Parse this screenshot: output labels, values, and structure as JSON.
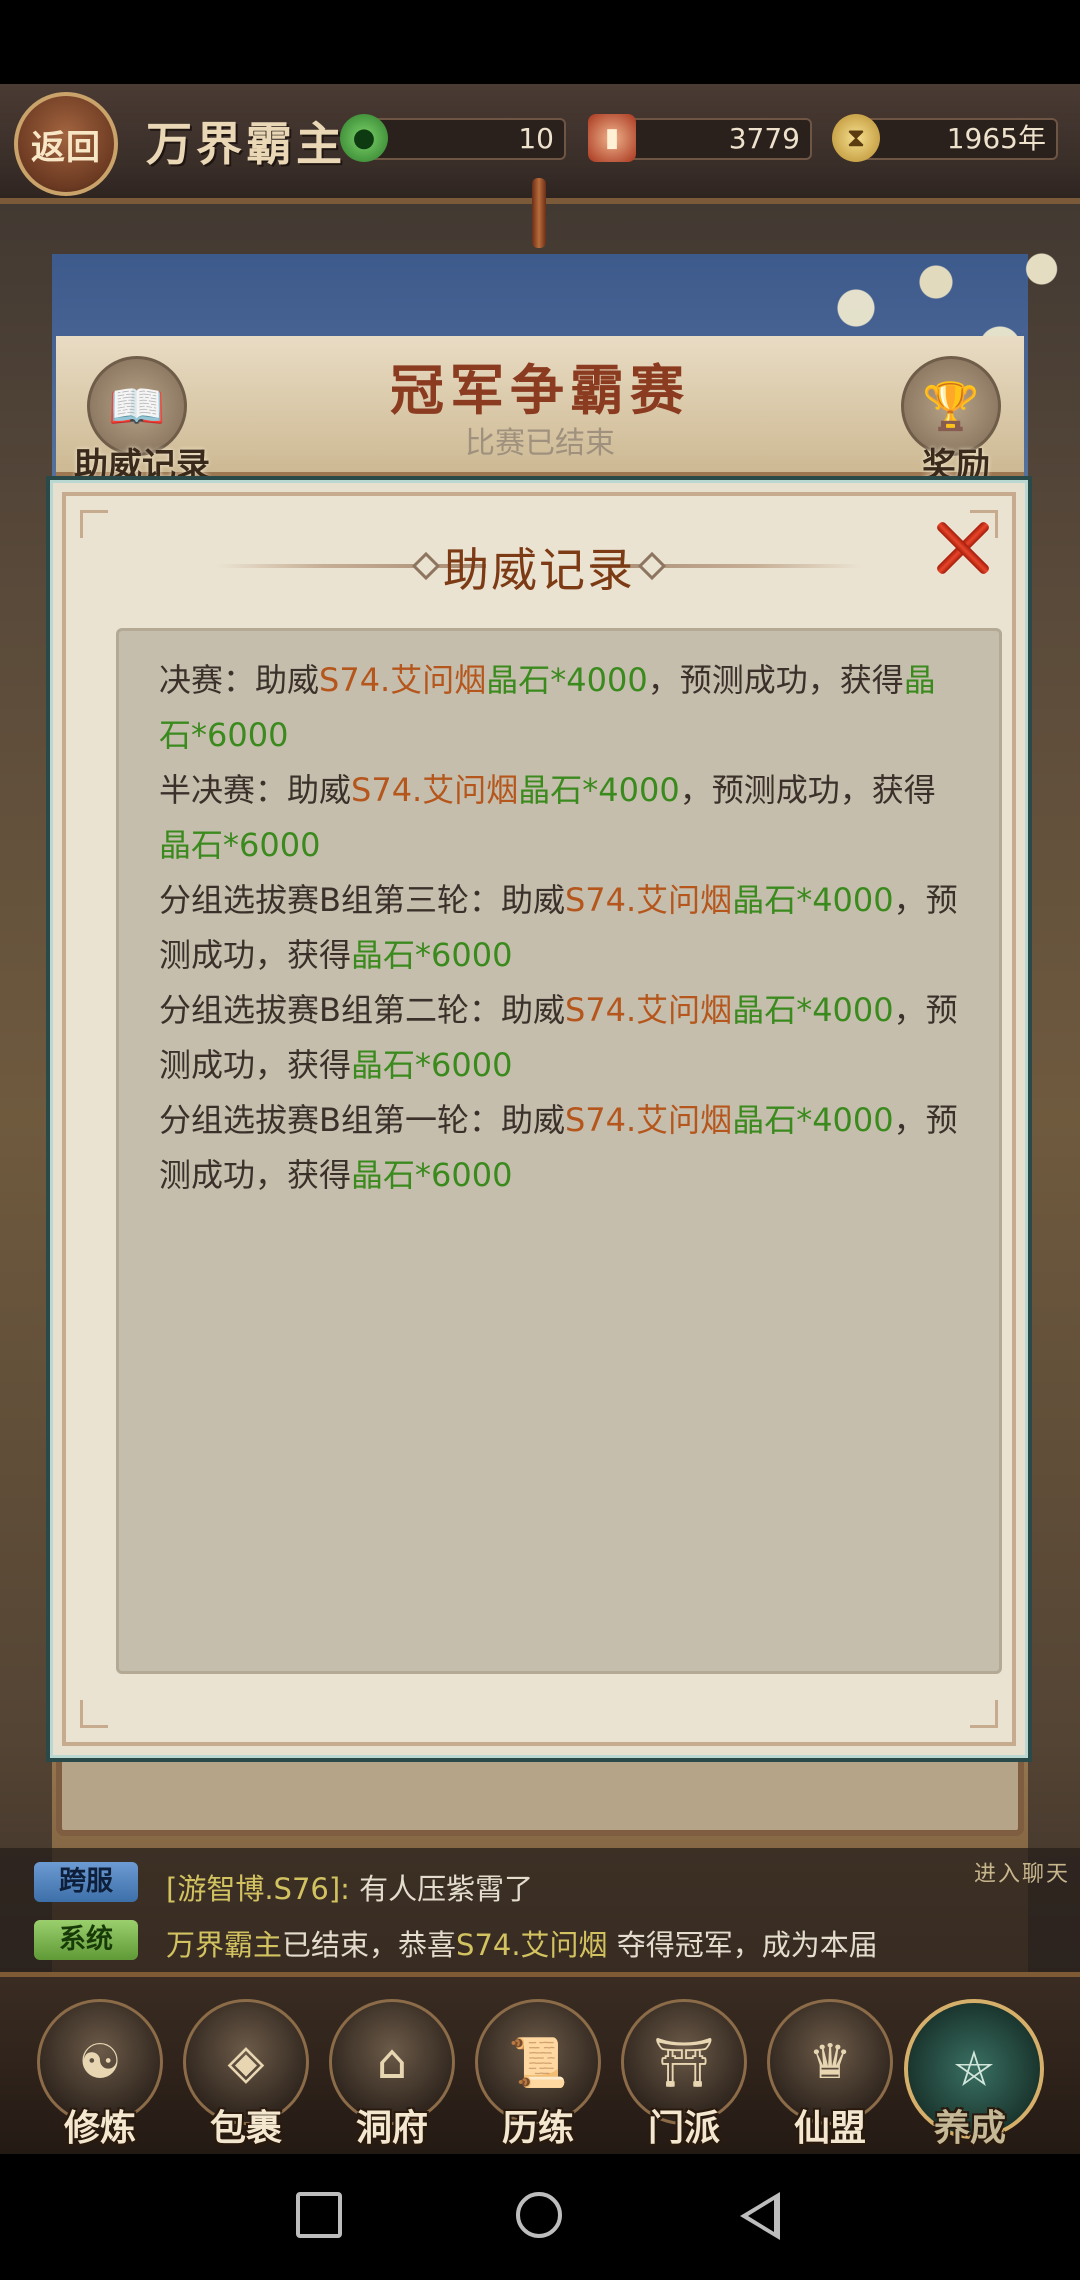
{
  "header": {
    "back_label": "返回",
    "title": "万界霸主",
    "resources": [
      {
        "icon": "jade-coin-icon",
        "value": "10"
      },
      {
        "icon": "red-pouch-icon",
        "value": "3779"
      },
      {
        "icon": "hourglass-icon",
        "value": "1965年"
      }
    ]
  },
  "event": {
    "title": "冠军争霸赛",
    "status": "比赛已结束",
    "left_button": "助威记录",
    "right_button": "奖励"
  },
  "modal": {
    "title": "助威记录",
    "records": [
      {
        "prefix": "决赛：助威",
        "player": "S74.艾问烟",
        "bet": "晶石*4000",
        "mid": "，预测成功，获得",
        "reward": "晶石*6000"
      },
      {
        "prefix": "半决赛：助威",
        "player": "S74.艾问烟",
        "bet": "晶石*4000",
        "mid": "，预测成功，获得",
        "reward": "晶石*6000"
      },
      {
        "prefix": "分组选拔赛B组第三轮：助威",
        "player": "S74.艾问烟",
        "bet": "晶石*4000",
        "mid": "，预测成功，获得",
        "reward": "晶石*6000"
      },
      {
        "prefix": "分组选拔赛B组第二轮：助威",
        "player": "S74.艾问烟",
        "bet": "晶石*4000",
        "mid": "，预测成功，获得",
        "reward": "晶石*6000"
      },
      {
        "prefix": "分组选拔赛B组第一轮：助威",
        "player": "S74.艾问烟",
        "bet": "晶石*4000",
        "mid": "，预测成功，获得",
        "reward": "晶石*6000"
      }
    ]
  },
  "chat": {
    "enter_label": "进入聊天",
    "line1": {
      "tag": "跨服",
      "name": "[游智博.S76]:",
      "text": "有人压紫霄了"
    },
    "line2": {
      "tag": "系统",
      "name": "万界霸主",
      "text1": "已结束，恭喜",
      "player": "S74.艾问烟",
      "text2": " 夺得冠军，成为本届"
    }
  },
  "nav": [
    {
      "label": "修炼",
      "icon": "cultivator-icon"
    },
    {
      "label": "包裹",
      "icon": "bag-icon"
    },
    {
      "label": "洞府",
      "icon": "mansion-icon"
    },
    {
      "label": "历练",
      "icon": "scroll-icon"
    },
    {
      "label": "门派",
      "icon": "gate-icon"
    },
    {
      "label": "仙盟",
      "icon": "alliance-icon"
    },
    {
      "label": "养成",
      "icon": "pentagram-icon"
    }
  ],
  "colors": {
    "orange": "#b5561c",
    "green": "#3b8a1e",
    "title": "#7d3b15"
  }
}
